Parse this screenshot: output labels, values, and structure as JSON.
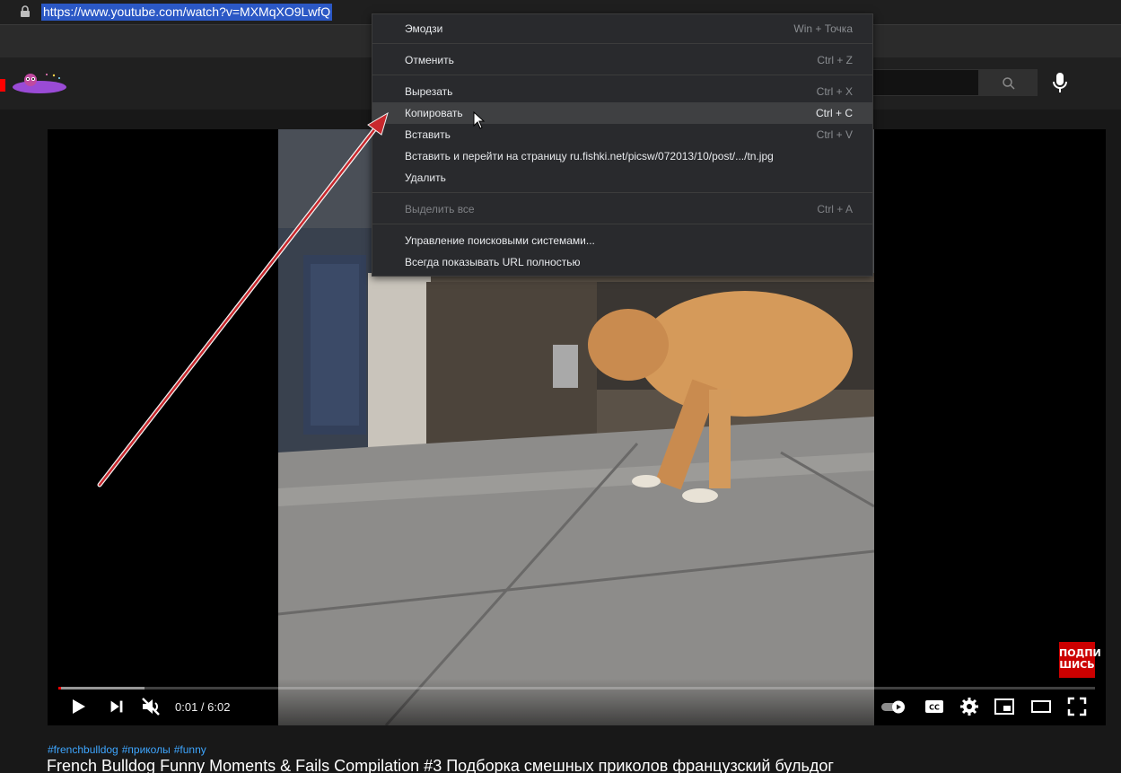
{
  "browser": {
    "url": "https://www.youtube.com/watch?v=MXMqXO9LwfQ"
  },
  "context_menu": {
    "items": [
      {
        "label": "Эмодзи",
        "shortcut": "Win + Точка"
      },
      {
        "label": "Отменить",
        "shortcut": "Ctrl + Z"
      },
      {
        "label": "Вырезать",
        "shortcut": "Ctrl + X"
      },
      {
        "label": "Копировать",
        "shortcut": "Ctrl + C",
        "highlighted": true
      },
      {
        "label": "Вставить",
        "shortcut": "Ctrl + V"
      },
      {
        "label": "Вставить и перейти на страницу ru.fishki.net/picsw/072013/10/post/.../tn.jpg",
        "shortcut": ""
      },
      {
        "label": "Удалить",
        "shortcut": ""
      },
      {
        "label": "Выделить все",
        "shortcut": "Ctrl + A",
        "disabled": true
      },
      {
        "label": "Управление поисковыми системами...",
        "shortcut": ""
      },
      {
        "label": "Всегда показывать URL полностью",
        "shortcut": ""
      }
    ]
  },
  "player": {
    "time": "0:01 / 6:02",
    "progress_fraction": 0.003,
    "loaded_fraction": 0.083,
    "subscribe_badge": "ПОДПИШИСЬ",
    "subscribe_line1": "ПОДПИ",
    "subscribe_line2": "ШИСЬ"
  },
  "video_info": {
    "hashtags": [
      "#frenchbulldog",
      "#приколы",
      "#funny"
    ],
    "title": "French Bulldog Funny Moments & Fails Compilation #3 Подборка смешных приколов французский бульдог"
  },
  "colors": {
    "accent_red": "#ff0000",
    "link_blue": "#3ea6ff",
    "url_highlight": "#2b58c5",
    "arrow": "#c8282d"
  },
  "icons": [
    "lock-icon",
    "search-icon",
    "mic-icon",
    "play-icon",
    "next-icon",
    "mute-icon",
    "autoplay-toggle-icon",
    "captions-icon",
    "settings-icon",
    "miniplayer-icon",
    "theater-icon",
    "fullscreen-icon",
    "cursor-icon"
  ]
}
